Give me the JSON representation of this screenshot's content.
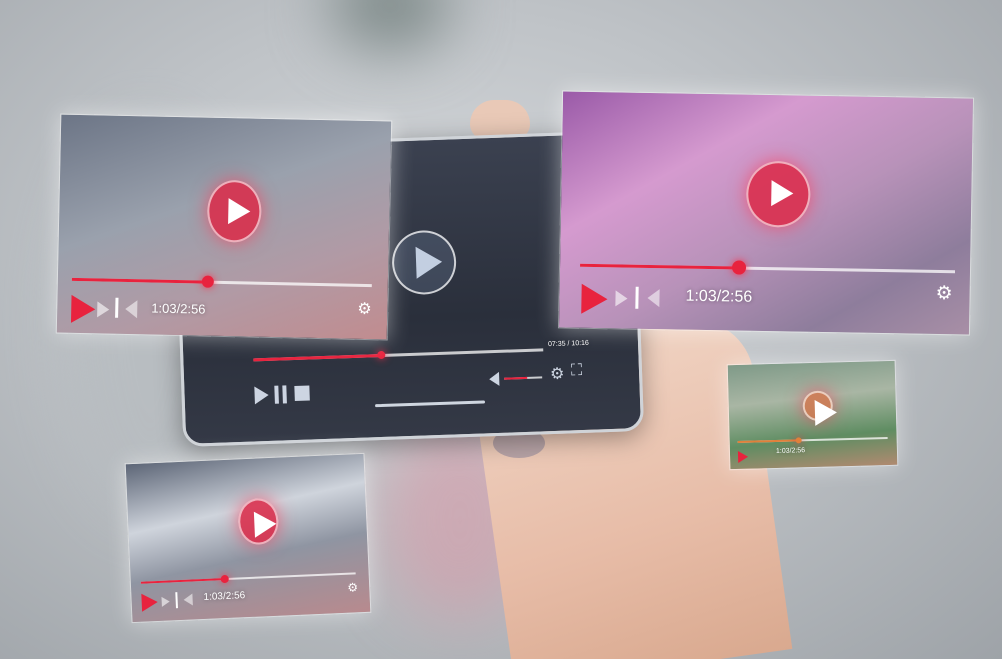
{
  "scene": {
    "description_colors": {
      "accent": "#e8233e",
      "background": "#c3c7cb",
      "phone_screen": "#2e3440"
    }
  },
  "phone": {
    "time_label": "07:35 / 10:16",
    "progress": 0.45
  },
  "player_top_left": {
    "time_label": "1:03/2:56",
    "progress": 0.45
  },
  "player_top_right": {
    "time_label": "1:03/2:56",
    "progress": 0.42
  },
  "player_bottom_left": {
    "time_label": "1:03/2:56",
    "progress": 0.38
  },
  "player_small_right": {
    "time_label": "1:03/2:56",
    "progress": 0.4
  },
  "icons": [
    "play-icon",
    "pause-icon",
    "stop-icon",
    "next-icon",
    "volume-icon",
    "settings-icon",
    "fullscreen-icon"
  ]
}
